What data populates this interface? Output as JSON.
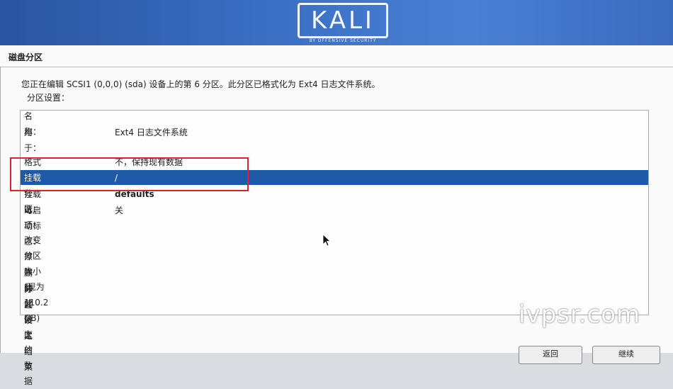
{
  "banner": {
    "logo": "KALI",
    "logo_sub": "BY OFFENSIVE SECURITY"
  },
  "page": {
    "title": "磁盘分区",
    "description": "您正在编辑 SCSI1 (0,0,0) (sda) 设备上的第 6 分区。此分区已格式化为 Ext4 日志文件系统。",
    "subheading": "分区设置："
  },
  "settings": [
    {
      "label": "名称：",
      "value": ""
    },
    {
      "label": "用于：",
      "value": "Ext4 日志文件系统"
    },
    {
      "label": "格式化此分区：",
      "value": "不，保持现有数据"
    },
    {
      "label": "挂载点：",
      "value": "/"
    },
    {
      "label": "挂载选项：",
      "value": "defaults"
    },
    {
      "label": "可启动标志：",
      "value": "关"
    }
  ],
  "actions": [
    "改变分区大小 (现为 110.2 GB)",
    "擦除此分区上的数据",
    "删除此分区",
    "分区设定结束"
  ],
  "selected_index": 3,
  "watermark": "ivpsr.com",
  "buttons": {
    "back": "返回",
    "continue": "继续"
  },
  "colors": {
    "banner": "#3a6fc4",
    "selection": "#1f5aa8",
    "highlight": "#e0202a"
  }
}
